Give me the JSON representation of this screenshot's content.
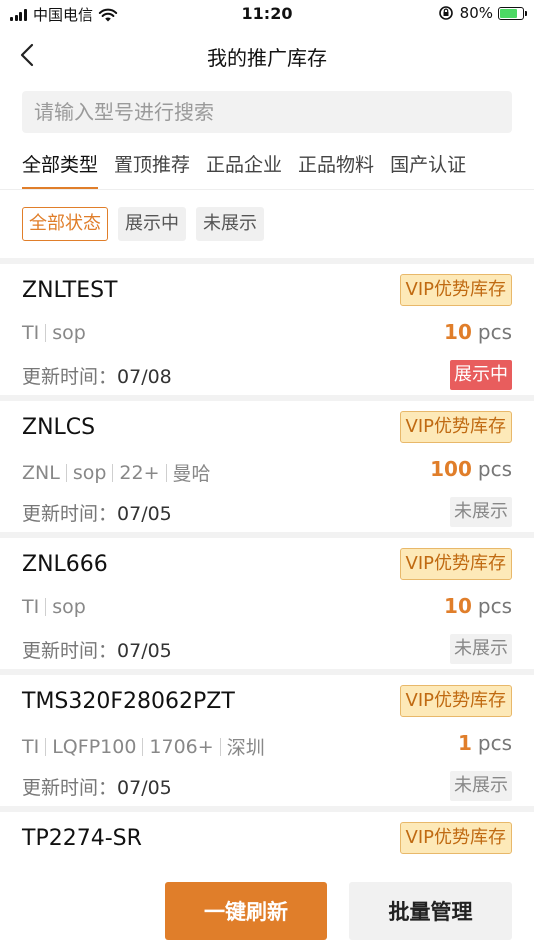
{
  "status": {
    "carrier": "中国电信",
    "time": "11:20",
    "battery": "80%",
    "battery_level": 0.8
  },
  "nav": {
    "title": "我的推广库存"
  },
  "search": {
    "placeholder": "请输入型号进行搜索"
  },
  "tabs": [
    {
      "label": "全部类型",
      "active": true
    },
    {
      "label": "置顶推荐",
      "active": false
    },
    {
      "label": "正品企业",
      "active": false
    },
    {
      "label": "正品物料",
      "active": false
    },
    {
      "label": "国产认证",
      "active": false
    }
  ],
  "filters": [
    {
      "label": "全部状态",
      "active": true
    },
    {
      "label": "展示中",
      "active": false
    },
    {
      "label": "未展示",
      "active": false
    }
  ],
  "items": [
    {
      "model": "ZNLTEST",
      "badge": "VIP优势库存",
      "attrs": [
        "TI",
        "sop"
      ],
      "qty": "10",
      "unit": "pcs",
      "updated_label": "更新时间：",
      "updated": "07/08",
      "state": "展示中",
      "state_on": true
    },
    {
      "model": "ZNLCS",
      "badge": "VIP优势库存",
      "attrs": [
        "ZNL",
        "sop",
        "22+",
        "曼哈"
      ],
      "qty": "100",
      "unit": "pcs",
      "updated_label": "更新时间：",
      "updated": "07/05",
      "state": "未展示",
      "state_on": false
    },
    {
      "model": "ZNL666",
      "badge": "VIP优势库存",
      "attrs": [
        "TI",
        "sop"
      ],
      "qty": "10",
      "unit": "pcs",
      "updated_label": "更新时间：",
      "updated": "07/05",
      "state": "未展示",
      "state_on": false
    },
    {
      "model": "TMS320F28062PZT",
      "badge": "VIP优势库存",
      "attrs": [
        "TI",
        "LQFP100",
        "1706+",
        "深圳"
      ],
      "qty": "1",
      "unit": "pcs",
      "updated_label": "更新时间：",
      "updated": "07/05",
      "state": "未展示",
      "state_on": false
    },
    {
      "model": "TP2274-SR",
      "badge": "VIP优势库存"
    }
  ],
  "actions": {
    "refresh": "一键刷新",
    "batch": "批量管理"
  },
  "colors": {
    "accent": "#e07e2a",
    "vip_bg": "#fde9b8",
    "state_on": "#e85d5d"
  }
}
